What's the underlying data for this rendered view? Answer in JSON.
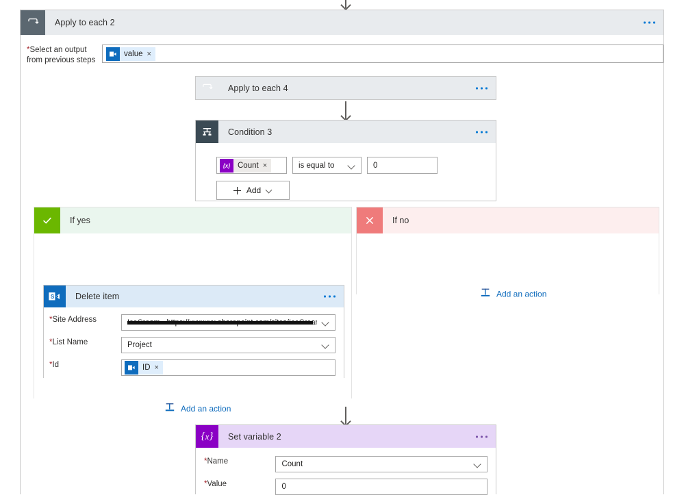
{
  "flow": {
    "apply_each_2": {
      "title": "Apply to each 2",
      "icon": "loop-icon",
      "more_label": "...",
      "output_field": {
        "label_line1": "Select an output",
        "label_line2": "from previous steps",
        "required_marker": "*",
        "token": {
          "text": "value",
          "remove": "×",
          "icon": "sharepoint-token-icon"
        }
      }
    },
    "apply_each_4": {
      "title": "Apply to each 4",
      "icon": "loop-icon",
      "more_label": "..."
    },
    "condition_3": {
      "title": "Condition 3",
      "icon": "condition-icon",
      "more_label": "...",
      "left_operand": {
        "text": "Count",
        "remove": "×",
        "icon": "variable-token-icon"
      },
      "operator": "is equal to",
      "right_operand": "0",
      "add_button": "Add"
    },
    "branch_yes": {
      "label": "If yes",
      "icon": "checkmark-icon",
      "action": {
        "title": "Delete item",
        "icon": "sharepoint-icon",
        "more_label": "...",
        "fields": [
          {
            "label": "Site Address",
            "required": "*",
            "value": "IceCream - https://xxxxxxx.sharepoint.com/sites/IceCream",
            "control": "dropdown"
          },
          {
            "label": "List Name",
            "required": "*",
            "value": "Project",
            "control": "dropdown"
          },
          {
            "label": "Id",
            "required": "*",
            "token": {
              "text": "ID",
              "remove": "×",
              "icon": "sharepoint-token-icon"
            },
            "control": "token"
          }
        ]
      },
      "add_action_label": "Add an action",
      "add_action_icon": "add-action-icon"
    },
    "branch_no": {
      "label": "If no",
      "icon": "close-icon",
      "add_action_label": "Add an action",
      "add_action_icon": "add-action-icon"
    },
    "set_variable_2": {
      "title": "Set variable 2",
      "icon": "variable-icon",
      "more_label": "...",
      "fields": [
        {
          "label": "Name",
          "required": "*",
          "value": "Count",
          "control": "dropdown"
        },
        {
          "label": "Value",
          "required": "*",
          "value": "0",
          "control": "text"
        }
      ]
    }
  },
  "colors": {
    "loop_header": "#e8ebee",
    "loop_icon": "#5b6770",
    "condition_icon": "#3b4a54",
    "yes_accent": "#6bb700",
    "no_accent": "#ef7b7b",
    "variable_accent": "#8a00c4",
    "sharepoint_accent": "#0f6cbd",
    "link": "#0f6cbd"
  }
}
